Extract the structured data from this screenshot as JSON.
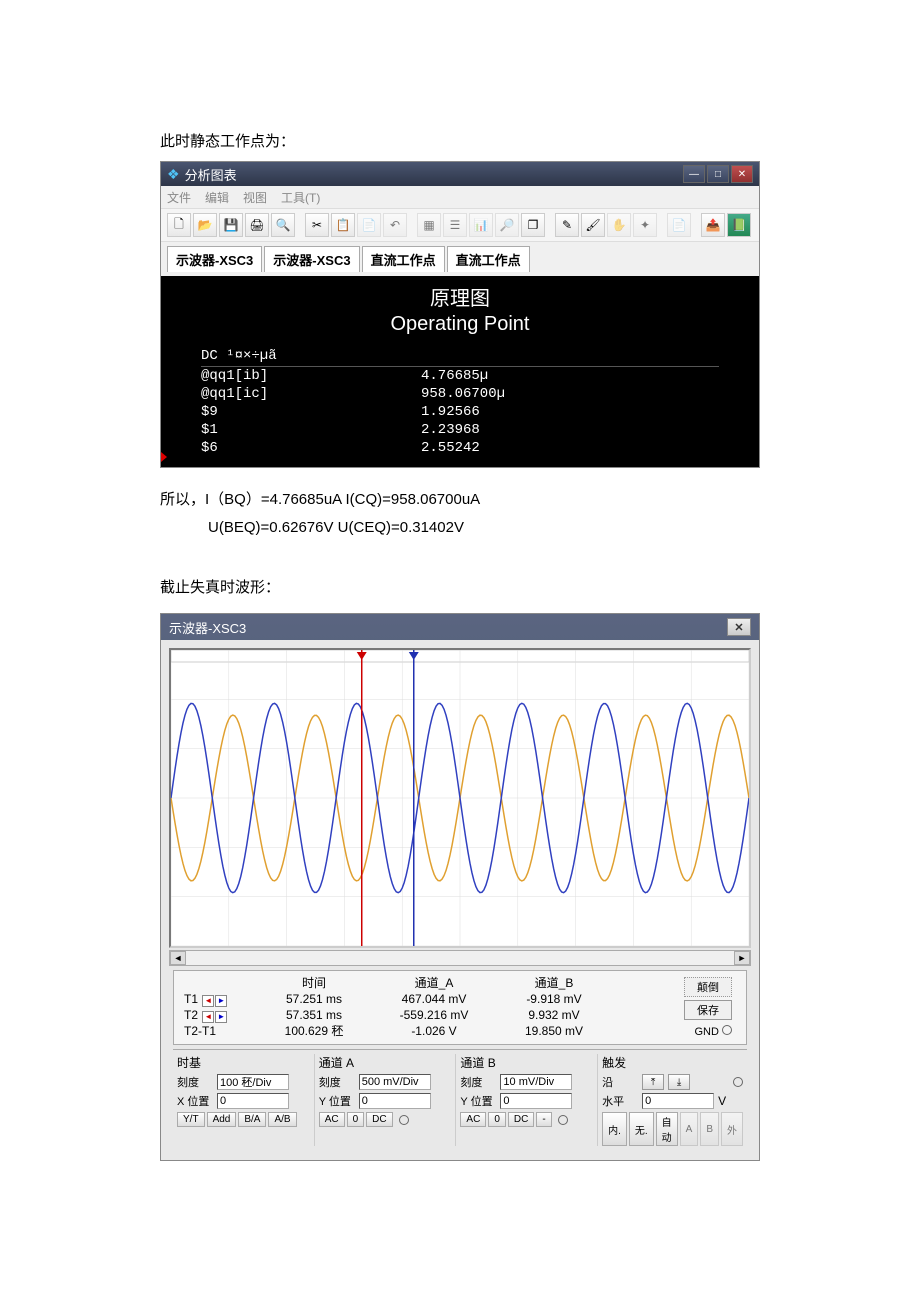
{
  "heading1": "此时静态工作点为：",
  "window1": {
    "title": "分析图表",
    "menu": [
      "文件",
      "编辑",
      "视图",
      "工具(T)"
    ],
    "tabs": [
      "示波器-XSC3",
      "示波器-XSC3",
      "直流工作点",
      "直流工作点"
    ],
    "chart_title": "原理图",
    "chart_subtitle": "Operating Point",
    "dc_header": "DC ¹¤×÷µã",
    "rows": [
      {
        "name": "@qq1[ib]",
        "value": "4.76685µ"
      },
      {
        "name": "@qq1[ic]",
        "value": "958.06700µ"
      },
      {
        "name": "$9",
        "value": "1.92566"
      },
      {
        "name": "$1",
        "value": "2.23968"
      },
      {
        "name": "$6",
        "value": "2.55242"
      }
    ]
  },
  "result_line1": "所以，I（BQ）=4.76685uA   I(CQ)=958.06700uA",
  "result_line2": "U(BEQ)=0.62676V    U(CEQ)=0.31402V",
  "heading2": "截止失真时波形：",
  "window2": {
    "title": "示波器-XSC3",
    "readout": {
      "time_label": "时间",
      "chA_label": "通道_A",
      "chB_label": "通道_B",
      "t1_label": "T1",
      "t2_label": "T2",
      "diff_label": "T2-T1",
      "t1_time": "57.251 ms",
      "t2_time": "57.351 ms",
      "diff_time": "100.629 秠",
      "t1_chA": "467.044 mV",
      "t2_chA": "-559.216 mV",
      "diff_chA": "-1.026 V",
      "t1_chB": "-9.918 mV",
      "t2_chB": "9.932 mV",
      "diff_chB": "19.850 mV",
      "reverse_btn": "颠倒",
      "save_btn": "保存",
      "gnd_label": "GND"
    },
    "timebase": {
      "title": "时基",
      "scale_label": "刻度",
      "scale_value": "100 秠/Div",
      "xpos_label": "X 位置",
      "xpos_value": "0",
      "buttons": [
        "Y/T",
        "Add",
        "B/A",
        "A/B"
      ]
    },
    "chA": {
      "title": "通道 A",
      "scale_label": "刻度",
      "scale_value": "500 mV/Div",
      "ypos_label": "Y 位置",
      "ypos_value": "0",
      "buttons": [
        "AC",
        "0",
        "DC"
      ]
    },
    "chB": {
      "title": "通道 B",
      "scale_label": "刻度",
      "scale_value": "10 mV/Div",
      "ypos_label": "Y 位置",
      "ypos_value": "0",
      "buttons": [
        "AC",
        "0",
        "DC",
        "-"
      ]
    },
    "trigger": {
      "title": "触发",
      "edge_label": "沿",
      "level_label": "水平",
      "level_value": "0",
      "level_unit": "V",
      "buttons": [
        "内.",
        "无.",
        "自动",
        "A",
        "B",
        "外"
      ]
    }
  },
  "chart_data": {
    "type": "line",
    "title": "Oscilloscope waveform",
    "x_range_divisions": 10,
    "y_range_divisions": 6,
    "cursors": {
      "t1_x_div": 3.3,
      "t2_x_div": 4.2
    },
    "series": [
      {
        "name": "Channel A",
        "color": "#e0a030",
        "shape": "sine",
        "periods": 7,
        "amplitude_fraction": 0.28,
        "phase_deg": 180,
        "offset": 0
      },
      {
        "name": "Channel B",
        "color": "#3040c0",
        "shape": "sine",
        "periods": 7,
        "amplitude_fraction": 0.32,
        "phase_deg": 0,
        "offset": 0
      }
    ]
  }
}
